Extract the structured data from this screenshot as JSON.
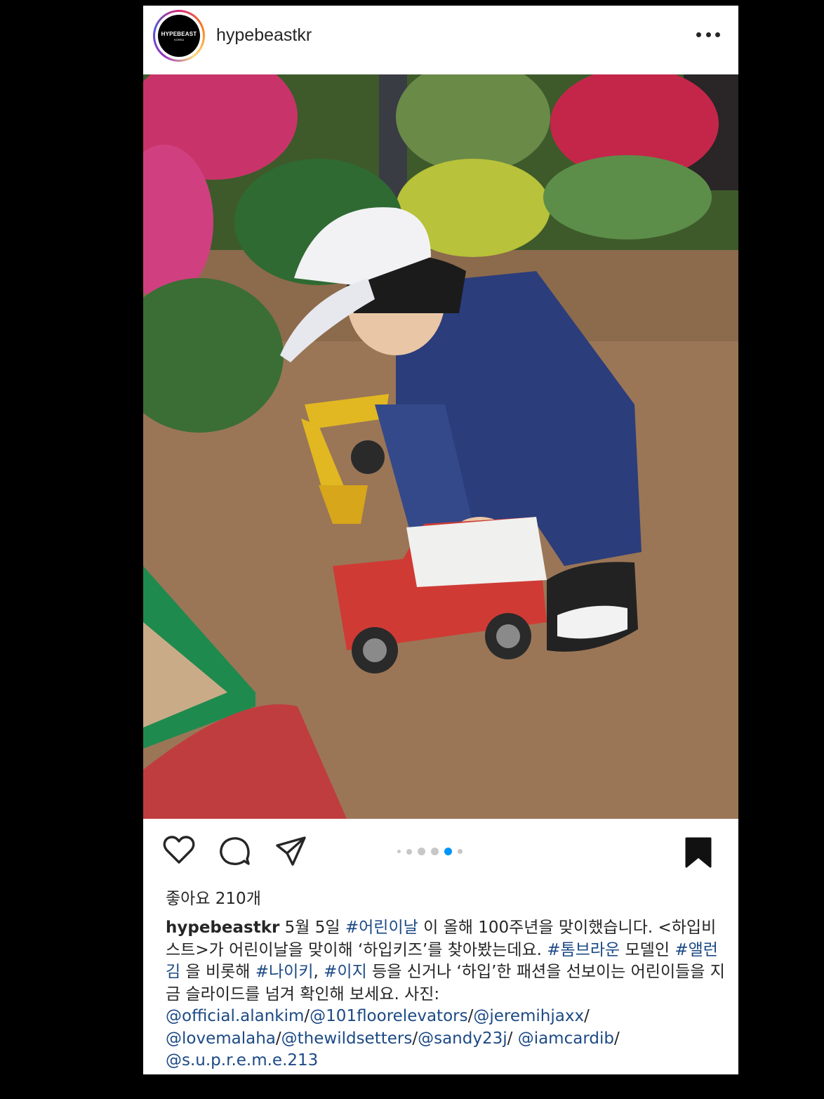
{
  "header": {
    "avatar_logo": "HYPEBEAST",
    "avatar_logo_sub": "KOREA",
    "username": "hypebeastkr"
  },
  "post": {
    "image_alt": "Child in an MLB cap and navy jacket playing with a red toy truck and a yellow toy excavator in a garden",
    "likes_label": "좋아요 210개",
    "carousel": {
      "count": 6,
      "active_index": 4
    },
    "caption": {
      "username": "hypebeastkr",
      "segments": [
        {
          "text": " 5월 5일 ",
          "tag": false
        },
        {
          "text": "#어린이날",
          "tag": true
        },
        {
          "text": " 이 올해 100주년을 맞이했습니다. <하입비스트>가 어린이날을 맞이해 ‘하입키즈’를 찾아봤는데요. ",
          "tag": false
        },
        {
          "text": "#톰브라운",
          "tag": true
        },
        {
          "text": " 모델인 ",
          "tag": false
        },
        {
          "text": "#앨런김",
          "tag": true
        },
        {
          "text": " 을 비롯해 ",
          "tag": false
        },
        {
          "text": "#나이키",
          "tag": true
        },
        {
          "text": ", ",
          "tag": false
        },
        {
          "text": "#이지",
          "tag": true
        },
        {
          "text": " 등을 신거나 ‘하입’한 패션을 선보이는 어린이들을 지금 슬라이드를 넘겨 확인해 보세요. 사진: ",
          "tag": false
        },
        {
          "text": "@official.alankim",
          "tag": true
        },
        {
          "text": "/",
          "tag": false
        },
        {
          "text": "@101floorelevators",
          "tag": true
        },
        {
          "text": "/",
          "tag": false
        },
        {
          "text": "@jeremihjaxx",
          "tag": true
        },
        {
          "text": "/ ",
          "tag": false
        },
        {
          "text": "@lovemalaha",
          "tag": true
        },
        {
          "text": "/",
          "tag": false
        },
        {
          "text": "@thewildsetters",
          "tag": true
        },
        {
          "text": "/",
          "tag": false
        },
        {
          "text": "@sandy23j",
          "tag": true
        },
        {
          "text": "/ ",
          "tag": false
        },
        {
          "text": "@iamcardib",
          "tag": true
        },
        {
          "text": "/ ",
          "tag": false
        },
        {
          "text": "@s.u.p.r.e.m.e.213",
          "tag": true
        }
      ]
    }
  },
  "icons": {
    "like": "heart-icon",
    "comment": "comment-icon",
    "share": "send-icon",
    "save": "bookmark-icon",
    "more": "more-icon"
  },
  "colors": {
    "background": "#000000",
    "card": "#ffffff",
    "text": "#262626",
    "hashtag": "#1c4a85",
    "carousel_active": "#0095f6",
    "carousel_inactive": "#c7c7c7"
  }
}
